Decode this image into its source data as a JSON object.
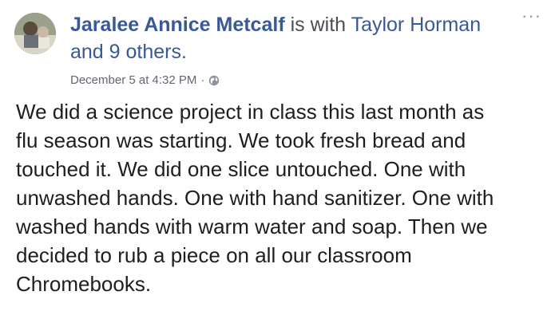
{
  "post": {
    "author": "Jaralee Annice Metcalf",
    "is_with": "is with",
    "tagged_first": "Taylor Horman",
    "and": "and",
    "tagged_others": "9 others",
    "period": ".",
    "timestamp": "December 5 at 4:32 PM",
    "separator": "·",
    "privacy_icon": "globe-icon",
    "more_icon": "more-options-icon",
    "more_glyph": "···",
    "body_lines": [
      "We did a science project in class this last month as",
      "flu season was starting. We took fresh bread and",
      "touched it. We did one slice untouched. One with",
      "unwashed hands. One with hand sanitizer. One with",
      "washed hands with warm water and soap. Then we",
      "decided to rub a piece on all our classroom",
      "Chromebooks."
    ]
  },
  "colors": {
    "link": "#385898",
    "text": "#1c1e21",
    "meta": "#616770"
  }
}
